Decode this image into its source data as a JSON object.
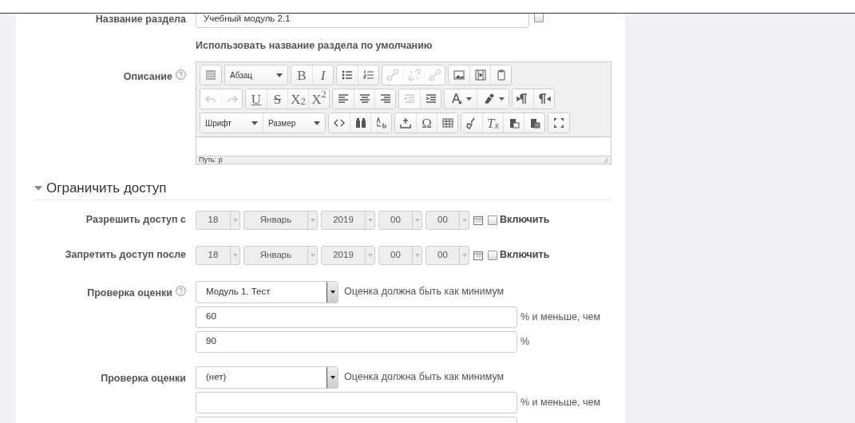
{
  "section_name": {
    "label": "Название раздела",
    "value": "Учебный модуль 2.1",
    "checked": false,
    "note": "Использовать название раздела по умолчанию"
  },
  "description": {
    "label": "Описание",
    "help": true,
    "toolbar": [
      [
        [
          {
            "kind": "icon"
          }
        ],
        [
          {
            "kind": "select",
            "label": "Абзац"
          }
        ],
        [
          {
            "kind": "serif",
            "glyph": "B"
          },
          {
            "kind": "italic",
            "glyph": "I"
          }
        ],
        [
          {
            "kind": "icon"
          },
          {
            "kind": "icon"
          }
        ],
        [
          {
            "kind": "icon",
            "disabled": true
          },
          {
            "kind": "icon",
            "disabled": true
          },
          {
            "kind": "icon",
            "disabled": true
          }
        ],
        [
          {
            "kind": "icon"
          },
          {
            "kind": "icon"
          },
          {
            "kind": "icon"
          }
        ]
      ],
      [
        [
          {
            "kind": "icon",
            "disabled": true
          },
          {
            "kind": "icon",
            "disabled": true
          }
        ],
        [
          {
            "kind": "underline",
            "glyph": "U"
          },
          {
            "kind": "strike",
            "glyph": "S"
          },
          {
            "kind": "serif",
            "glyph": "X$_{2}$"
          },
          {
            "kind": "serif",
            "glyph": "X$^{2}$"
          }
        ],
        [
          {
            "kind": "icon"
          },
          {
            "kind": "icon"
          },
          {
            "kind": "icon"
          }
        ],
        [
          {
            "kind": "icon",
            "disabled": true
          },
          {
            "kind": "icon"
          }
        ],
        [
          {
            "kind": "split"
          },
          {
            "kind": "split"
          }
        ],
        [
          {
            "kind": "icon"
          },
          {
            "kind": "icon"
          }
        ]
      ],
      [
        [
          {
            "kind": "select",
            "label": "Шрифт"
          },
          {
            "kind": "select",
            "label": "Размер"
          }
        ],
        [
          {
            "kind": "icon"
          },
          {
            "kind": "icon"
          },
          {
            "kind": "icon"
          }
        ],
        [
          {
            "kind": "icon"
          },
          {
            "kind": "serif",
            "glyph": "Ω"
          },
          {
            "kind": "icon"
          }
        ],
        [
          {
            "kind": "icon"
          },
          {
            "kind": "italic",
            "glyph": "T$_{x}$"
          },
          {
            "kind": "icon"
          },
          {
            "kind": "icon"
          }
        ],
        [
          {
            "kind": "icon"
          }
        ]
      ]
    ],
    "path": "Путь: p"
  },
  "restrict_access": {
    "title": "Ограничить доступ",
    "expanded": true,
    "date_rows": [
      {
        "label": "Разрешить доступ с",
        "fields": [
          {
            "value": "18",
            "disabled": true
          },
          {
            "value": "Январь",
            "disabled": true
          },
          {
            "value": "2019",
            "disabled": true
          },
          {
            "value": "00",
            "disabled": true
          },
          {
            "value": "00",
            "disabled": true
          }
        ],
        "enable": {
          "label": "Включить",
          "checked": false
        }
      },
      {
        "label": "Запретить доступ после",
        "fields": [
          {
            "value": "18",
            "disabled": true
          },
          {
            "value": "Январь",
            "disabled": true
          },
          {
            "value": "2019",
            "disabled": true
          },
          {
            "value": "00",
            "disabled": true
          },
          {
            "value": "00",
            "disabled": true
          }
        ],
        "enable": {
          "label": "Включить",
          "checked": false
        }
      }
    ],
    "grade_checks": [
      {
        "label": "Проверка оценки",
        "help": true,
        "activity": "Модуль 1. Тест",
        "min_text": "Оценка должна быть как минимум",
        "min_value": "60",
        "max_label": "% и меньше, чем",
        "max_value": "90",
        "unit": "%"
      },
      {
        "label": "Проверка оценки",
        "help": false,
        "activity": "(нет)",
        "min_text": "Оценка должна быть как минимум",
        "max_label": "% и меньше, чем"
      }
    ]
  }
}
